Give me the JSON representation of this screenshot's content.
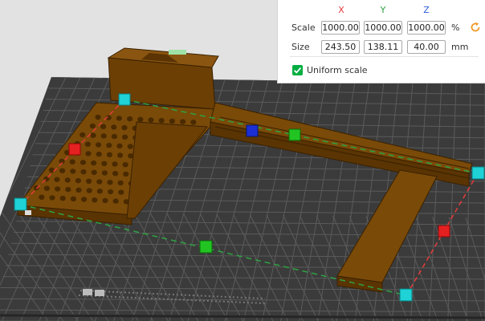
{
  "scale_panel": {
    "axes": {
      "x": "X",
      "y": "Y",
      "z": "Z"
    },
    "scale_label": "Scale",
    "size_label": "Size",
    "scale": {
      "x": "1000.00",
      "y": "1000.00",
      "z": "1000.00"
    },
    "size": {
      "x": "243.50",
      "y": "138.11",
      "z": "40.00"
    },
    "scale_unit": "%",
    "size_unit": "mm",
    "uniform_label": "Uniform scale",
    "uniform_checked": true
  },
  "colors": {
    "axis_x": "#e33b3b",
    "axis_y": "#2ea042",
    "axis_z": "#2e5fd8",
    "accent": "#00ae42",
    "reset_icon": "#f09a2a",
    "plate": "#3b3b3b",
    "plate_grid": "#5b5b5b",
    "model": "#7a4a08",
    "handle_corner": "#1ed2d6"
  }
}
